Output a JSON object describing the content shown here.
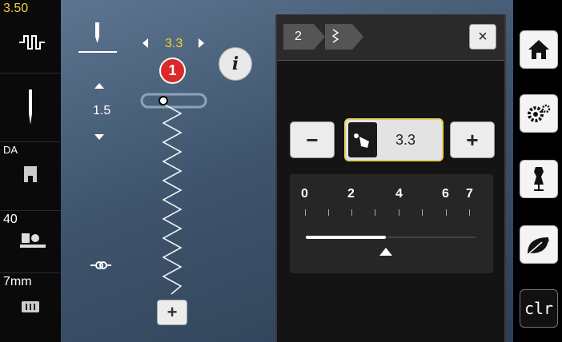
{
  "left_panel": {
    "stitch_width": "3.50",
    "presser_foot_pressure": "DA",
    "foot_pressure_value": "40",
    "plate_value": "7mm"
  },
  "stitch_panel": {
    "stitch_length": "3.3",
    "needle_position": "1.5",
    "badge_number": "1",
    "info_label": "i",
    "add_label": "+"
  },
  "dialog": {
    "breadcrumb_step": "2",
    "close_label": "×",
    "minus_label": "−",
    "plus_label": "+",
    "value": "3.3",
    "slider": {
      "ticks": [
        "0",
        "2",
        "4",
        "6",
        "7"
      ],
      "min": 0,
      "max": 7,
      "value": 3.3
    }
  },
  "right_panel": {
    "clr_label": "clr",
    "eco_label": "eco"
  },
  "colors": {
    "accent_yellow": "#f2d23c",
    "badge_red": "#d9292b"
  }
}
